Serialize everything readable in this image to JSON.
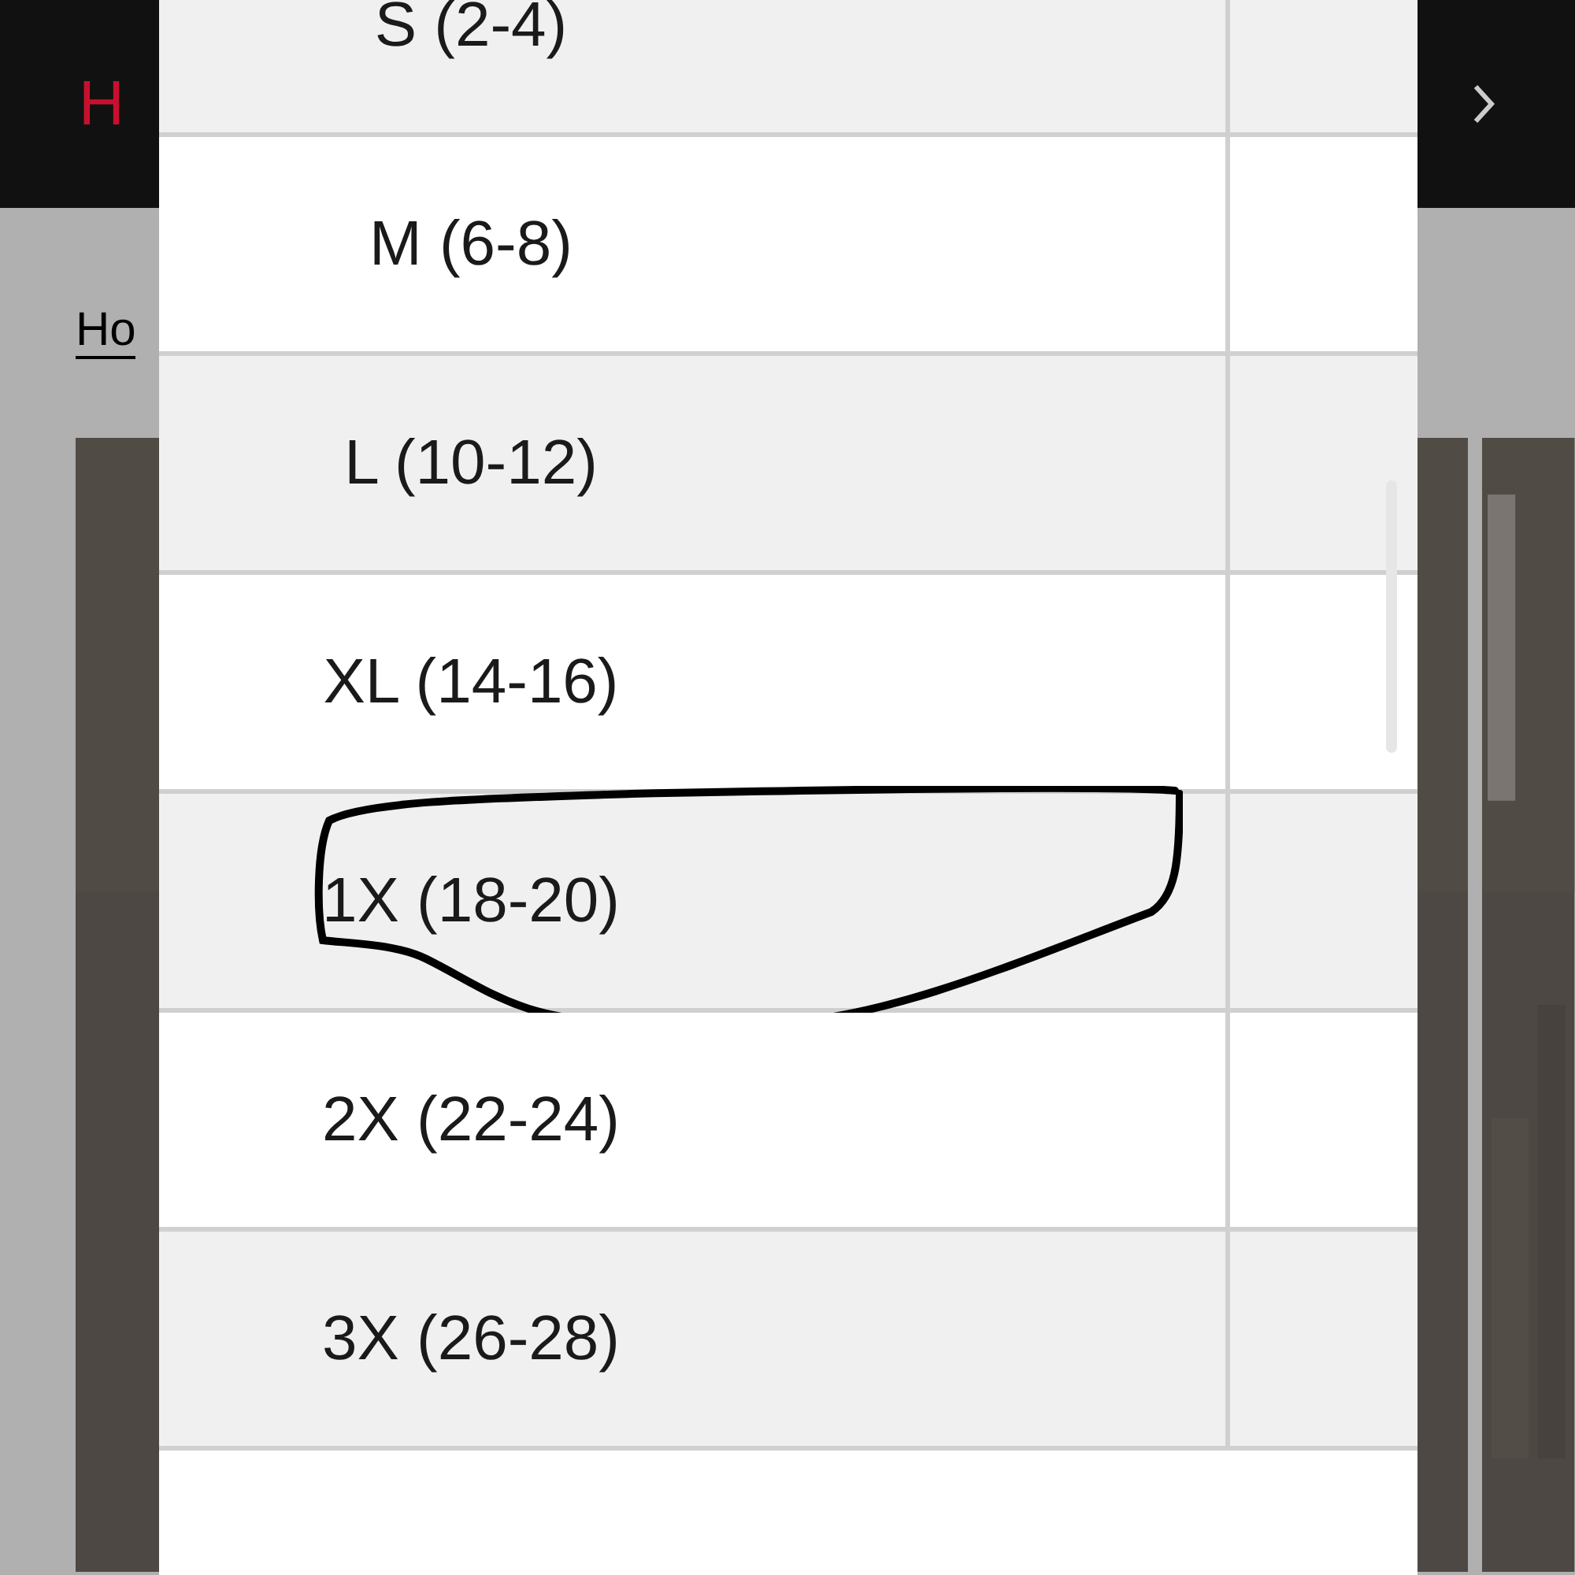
{
  "header": {
    "logo_text": "H"
  },
  "breadcrumb": {
    "link": "Ho"
  },
  "size_list": {
    "rows": [
      {
        "label": "S (2-4)",
        "circled": false
      },
      {
        "label": "M (6-8)",
        "circled": false
      },
      {
        "label": "L (10-12)",
        "circled": false
      },
      {
        "label": "XL (14-16)",
        "circled": false
      },
      {
        "label": "1X (18-20)",
        "circled": true
      },
      {
        "label": "2X (22-24)",
        "circled": false
      },
      {
        "label": "3X (26-28)",
        "circled": false
      }
    ]
  }
}
